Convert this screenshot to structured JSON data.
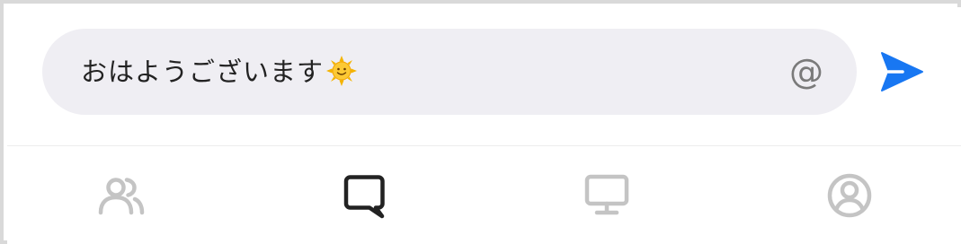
{
  "composer": {
    "message_value": "おはようございます",
    "emoji": "sun-with-face",
    "mention_label": "@",
    "send_icon": "send-arrow-icon",
    "accent_color": "#1877f2",
    "pill_color": "#efeef3"
  },
  "tabbar": {
    "tabs": [
      {
        "icon": "friends-icon",
        "active": false
      },
      {
        "icon": "chat-icon",
        "active": true
      },
      {
        "icon": "monitor-icon",
        "active": false
      },
      {
        "icon": "profile-icon",
        "active": false
      }
    ],
    "active_color": "#222222",
    "inactive_color": "#c4c4c4"
  }
}
